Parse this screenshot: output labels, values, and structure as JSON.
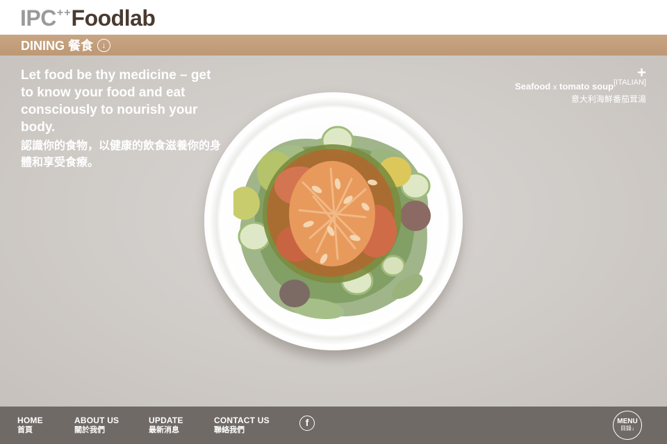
{
  "header": {
    "logo_ipc": "IPC",
    "logo_plus": "++",
    "logo_foodlab": "Foodlab"
  },
  "section": {
    "title": "DINING 餐食",
    "arrow_icon": "circle-arrow-down-icon"
  },
  "intro": {
    "en": "Let food be thy medicine – get to know your food and eat consciously to nourish your body.",
    "zh": "認識你的食物，以健康的飲食滋養你的身體和享受食療。"
  },
  "dish": {
    "plus": "+",
    "name_part1": "Seafood",
    "separator": "x",
    "name_part2": "tomato soup",
    "tag": "[ITALIAN]",
    "name_zh": "意大利海鮮番茄茸湯"
  },
  "footer": {
    "nav": [
      {
        "en": "HOME",
        "zh": "首頁"
      },
      {
        "en": "ABOUT US",
        "zh": "關於我們"
      },
      {
        "en": "UPDATE",
        "zh": "最新消息"
      },
      {
        "en": "CONTACT US",
        "zh": "聯絡我們"
      }
    ],
    "facebook": "f",
    "menu_en": "MENU",
    "menu_zh": "目錄↓"
  },
  "colors": {
    "section_bar": "#c4a07e",
    "background": "#d2ceca",
    "footer": "#6f6a66",
    "logo_dark": "#4a3a30",
    "logo_grey": "#9a9a9a"
  }
}
